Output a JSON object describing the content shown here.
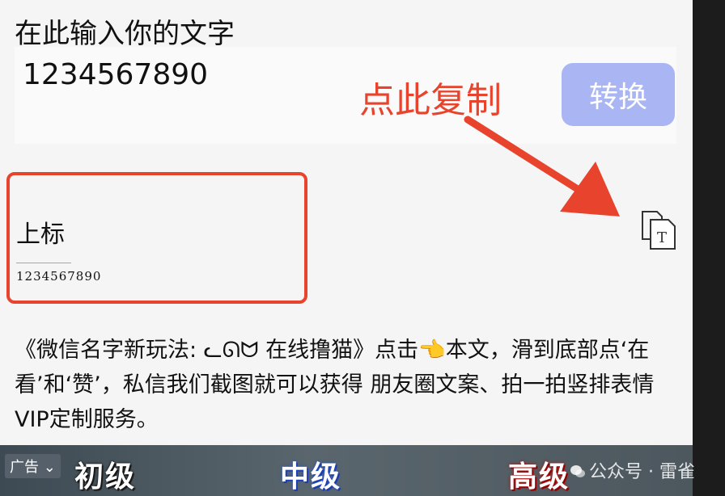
{
  "header": {
    "title": "在此输入你的文字"
  },
  "input": {
    "value": "1234567890"
  },
  "convert_button": {
    "label": "转换"
  },
  "annotation": {
    "hint": "点此复制"
  },
  "result": {
    "label": "上标",
    "text": "1234567890"
  },
  "article": {
    "text": "《微信名字新玩法: ᓚᘏᗢ 在线撸猫》点击👈本文，滑到底部点‘在看’和‘赞’，私信我们截图就可以获得 朋友圈文案、拍一拍竖排表情 VIP定制服务。"
  },
  "banner": {
    "ad_tag": "广告",
    "levels": [
      "初级",
      "中级",
      "高级"
    ],
    "watermark": "公众号 · 雷雀"
  },
  "colors": {
    "accent_red": "#e8432c",
    "button_blue": "#a9b6f3"
  }
}
